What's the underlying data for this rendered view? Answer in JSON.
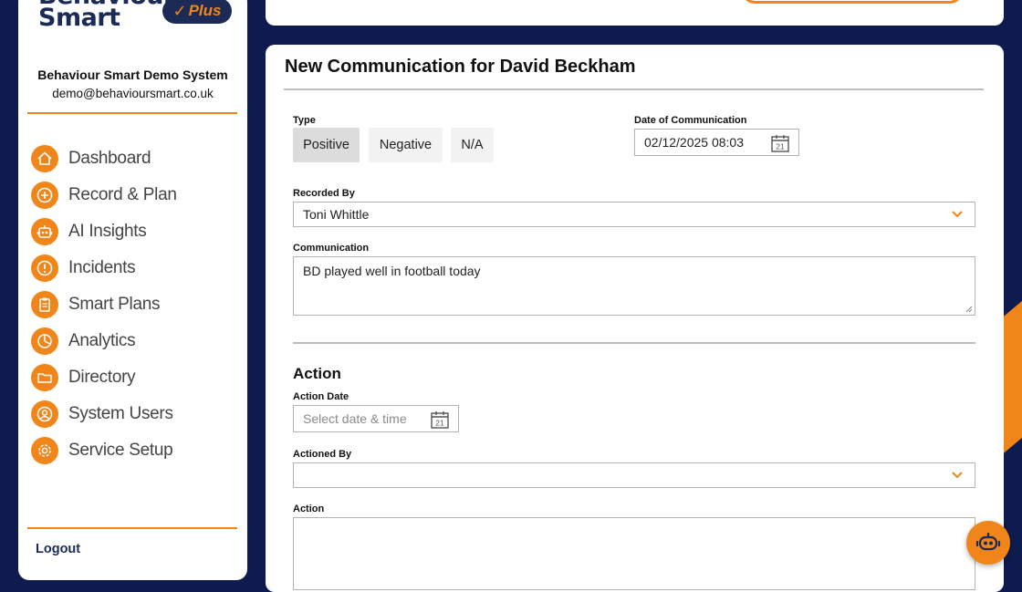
{
  "colors": {
    "brand_navy": "#1c2b56",
    "accent_orange": "#f0861a",
    "background": "#0d1b4f"
  },
  "brand": {
    "name_line1": "Behaviour",
    "name_line2": "Smart",
    "badge": "Plus"
  },
  "sidebar": {
    "system_name": "Behaviour Smart Demo System",
    "email": "demo@behavioursmart.co.uk",
    "items": [
      {
        "label": "Dashboard",
        "icon": "home-icon"
      },
      {
        "label": "Record & Plan",
        "icon": "plus-circle-icon"
      },
      {
        "label": "AI Insights",
        "icon": "robot-icon"
      },
      {
        "label": "Incidents",
        "icon": "alert-icon"
      },
      {
        "label": "Smart Plans",
        "icon": "clipboard-icon"
      },
      {
        "label": "Analytics",
        "icon": "pie-chart-icon"
      },
      {
        "label": "Directory",
        "icon": "folder-icon"
      },
      {
        "label": "System Users",
        "icon": "user-icon"
      },
      {
        "label": "Service Setup",
        "icon": "gear-icon"
      }
    ],
    "logout": "Logout"
  },
  "form": {
    "title": "New Communication for David Beckham",
    "type": {
      "label": "Type",
      "options": [
        "Positive",
        "Negative",
        "N/A"
      ],
      "selected": "Positive"
    },
    "date_of_communication": {
      "label": "Date of Communication",
      "value": "02/12/2025 08:03",
      "calendar_day": "21"
    },
    "recorded_by": {
      "label": "Recorded By",
      "value": "Toni Whittle"
    },
    "communication": {
      "label": "Communication",
      "value": "BD played well in football today"
    },
    "action_section": {
      "title": "Action",
      "action_date": {
        "label": "Action Date",
        "placeholder": "Select date & time",
        "calendar_day": "21"
      },
      "actioned_by": {
        "label": "Actioned By",
        "value": ""
      },
      "action": {
        "label": "Action",
        "value": ""
      }
    }
  }
}
